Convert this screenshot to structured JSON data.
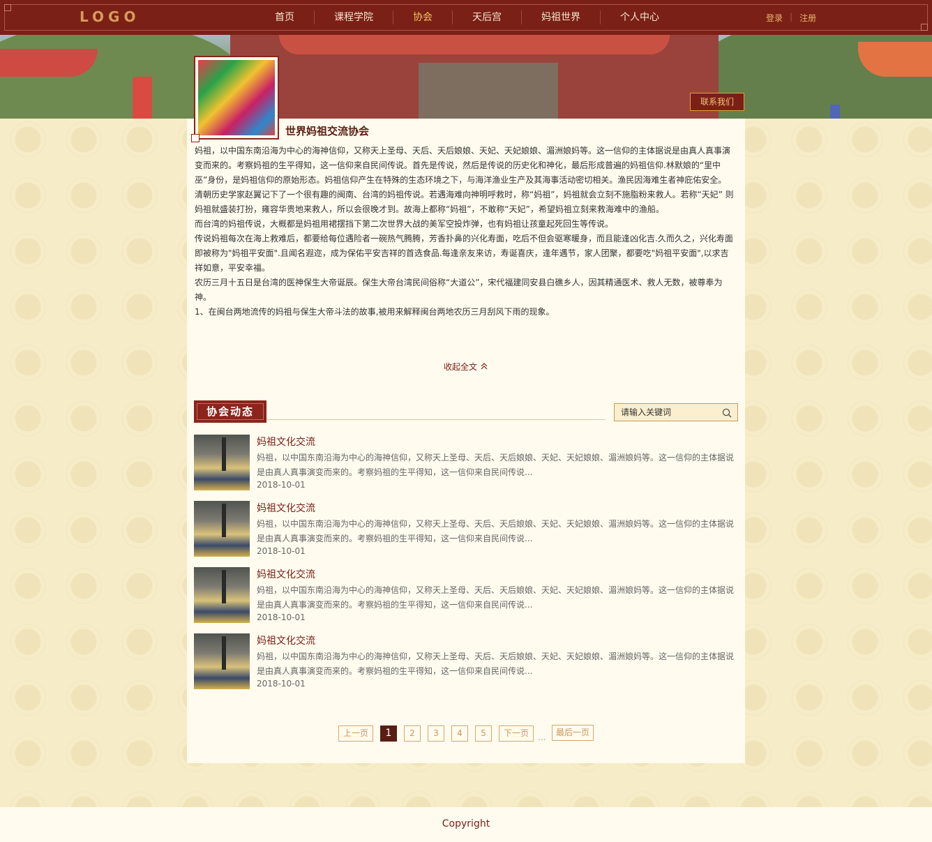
{
  "header": {
    "logo": "LOGO",
    "nav": [
      "首页",
      "课程学院",
      "协会",
      "天后宫",
      "妈祖世界",
      "个人中心"
    ],
    "active_nav": "协会",
    "login": "登录",
    "register": "注册"
  },
  "banner": {
    "contact_label": "联系我们"
  },
  "org": {
    "title": "世界妈祖交流协会",
    "paragraphs": [
      "妈祖，以中国东南沿海为中心的海神信仰，又称天上圣母、天后、天后娘娘、天妃、天妃娘娘、湄洲娘妈等。这一信仰的主体据说是由真人真事演变而来的。考察妈祖的生平得知，这一信仰来自民间传说。首先是传说，然后是传说的历史化和神化，最后形成普遍的妈祖信仰.林默娘的“里中巫”身份，是妈祖信仰的原始形态。妈祖信仰产生在特殊的生态环境之下，与海洋渔业生产及其海事活动密切相关。渔民因海难生者神庇佑安全。",
      "清朝历史学家赵翼记下了一个很有趣的闽南、台湾的妈祖传说。若遇海难向神明呼救时，称“妈祖”，妈祖就会立刻不施脂粉来救人。若称“天妃” 则妈祖就盛装打扮，雍容华贵地来救人，所以会很晚才到。故海上都称“妈祖”，不敢称“天妃”，希望妈祖立刻来救海难中的渔船。",
      "而台湾的妈祖传说，大概都是妈祖用裙摆挡下第二次世界大战的美军空投炸弹，也有妈祖让孩童起死回生等传说。",
      "传说妈祖每次在海上救难后，都要给每位遇险者一碗热气腾腾，芳香扑鼻的兴化寿面，吃后不但会驱寒暖身，而且能逢凶化吉.久而久之，兴化寿面即被称为\"妈祖平安面\".且闻名遐迩，成为保佑平安吉祥的首选食品.每逢亲友来访，寿诞喜庆，逢年遇节，家人团聚，都要吃\"妈祖平安面\",以求吉祥如意，平安幸福。",
      "农历三月十五日是台湾的医神保生大帝诞辰。保生大帝台湾民间俗称“大道公”，宋代福建同安县白礁乡人，因其精通医术、救人无数，被尊奉为神。",
      "1、在闽台两地流传的妈祖与保生大帝斗法的故事,被用来解释闽台两地农历三月刮风下雨的现象。"
    ],
    "collapse_label": "收起全文"
  },
  "news_section": {
    "title": "协会动态",
    "search_placeholder": "请输入关键词",
    "items": [
      {
        "title": "妈祖文化交流",
        "desc": "妈祖，以中国东南沿海为中心的海神信仰，又称天上圣母、天后、天后娘娘、天妃、天妃娘娘、湄洲娘妈等。这一信仰的主体据说是由真人真事演变而来的。考察妈祖的生平得知，这一信仰来自民间传说...",
        "date": "2018-10-01"
      },
      {
        "title": "妈祖文化交流",
        "desc": "妈祖，以中国东南沿海为中心的海神信仰，又称天上圣母、天后、天后娘娘、天妃、天妃娘娘、湄洲娘妈等。这一信仰的主体据说是由真人真事演变而来的。考察妈祖的生平得知，这一信仰来自民间传说...",
        "date": "2018-10-01"
      },
      {
        "title": "妈祖文化交流",
        "desc": "妈祖，以中国东南沿海为中心的海神信仰，又称天上圣母、天后、天后娘娘、天妃、天妃娘娘、湄洲娘妈等。这一信仰的主体据说是由真人真事演变而来的。考察妈祖的生平得知，这一信仰来自民间传说...",
        "date": "2018-10-01"
      },
      {
        "title": "妈祖文化交流",
        "desc": "妈祖，以中国东南沿海为中心的海神信仰，又称天上圣母、天后、天后娘娘、天妃、天妃娘娘、湄洲娘妈等。这一信仰的主体据说是由真人真事演变而来的。考察妈祖的生平得知，这一信仰来自民间传说...",
        "date": "2018-10-01"
      }
    ]
  },
  "pager": {
    "prev": "上一页",
    "pages": [
      "1",
      "2",
      "3",
      "4",
      "5"
    ],
    "current": "1",
    "next": "下一页",
    "ellipsis": "...",
    "last": "最后一页"
  },
  "footer": {
    "copyright": "Copyright"
  }
}
